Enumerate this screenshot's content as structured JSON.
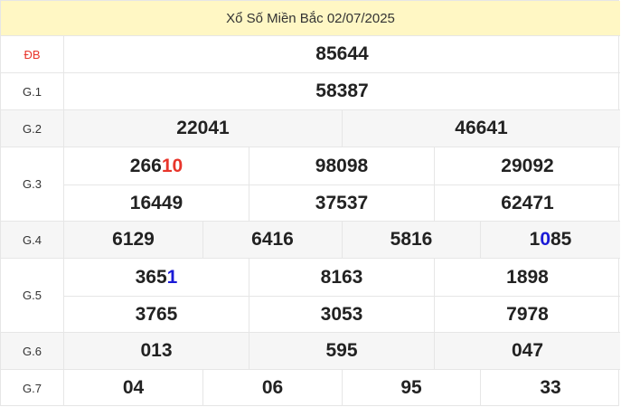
{
  "title": "Xổ Số Miền Bắc 02/07/2025",
  "colors": {
    "header_bg": "#fff7c4",
    "border": "#e6e6e6",
    "shade": "#f6f6f6",
    "red": "#e8352b",
    "blue": "#1a1ad6"
  },
  "prizes": {
    "db": {
      "label": "ĐB",
      "numbers": [
        "85644"
      ]
    },
    "g1": {
      "label": "G.1",
      "numbers": [
        "58387"
      ]
    },
    "g2": {
      "label": "G.2",
      "numbers": [
        "22041",
        "46641"
      ]
    },
    "g3": {
      "label": "G.3",
      "numbers": [
        "26610",
        "98098",
        "29092",
        "16449",
        "37537",
        "62471"
      ]
    },
    "g4": {
      "label": "G.4",
      "numbers": [
        "6129",
        "6416",
        "5816",
        "1085"
      ]
    },
    "g5": {
      "label": "G.5",
      "numbers": [
        "3651",
        "8163",
        "1898",
        "3765",
        "3053",
        "7978"
      ]
    },
    "g6": {
      "label": "G.6",
      "numbers": [
        "013",
        "595",
        "047"
      ]
    },
    "g7": {
      "label": "G.7",
      "numbers": [
        "04",
        "06",
        "95",
        "33"
      ]
    }
  },
  "highlights": {
    "g3_0": {
      "pre": "266",
      "mark": "10",
      "post": ""
    },
    "g4_3": {
      "pre": "1",
      "mark": "0",
      "post": "85"
    },
    "g5_0": {
      "pre": "365",
      "mark": "1",
      "post": ""
    }
  }
}
